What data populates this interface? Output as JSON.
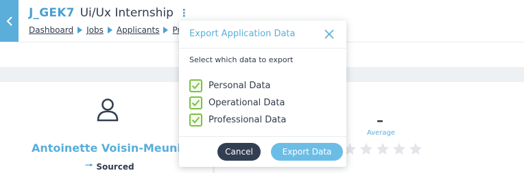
{
  "header": {
    "job_code": "J_GEK7",
    "job_title": "Ui/Ux Internship",
    "menu_icon": "kebab-vertical-icon",
    "back_icon": "chevron-left-icon",
    "breadcrumb": [
      "Dashboard",
      "Jobs",
      "Applicants",
      "Pr"
    ]
  },
  "applicant": {
    "name": "Antoinette Voisin-Meunie",
    "status": "Sourced",
    "status_icon": "arrow-right-icon",
    "avatar_icon": "person-outline-icon"
  },
  "rating": {
    "value": "–",
    "label": "Average",
    "stars_filled": 0,
    "stars_total": 5
  },
  "modal": {
    "title": "Export Application Data",
    "subtitle": "Select which data to export",
    "options": [
      {
        "label": "Personal Data",
        "checked": true
      },
      {
        "label": "Operational Data",
        "checked": true
      },
      {
        "label": "Professional Data",
        "checked": true
      }
    ],
    "cancel_label": "Cancel",
    "export_label": "Export Data"
  },
  "colors": {
    "accent": "#5aaed9",
    "dark": "#323f53",
    "check": "#7cc046",
    "star": "#e2e5e9"
  }
}
